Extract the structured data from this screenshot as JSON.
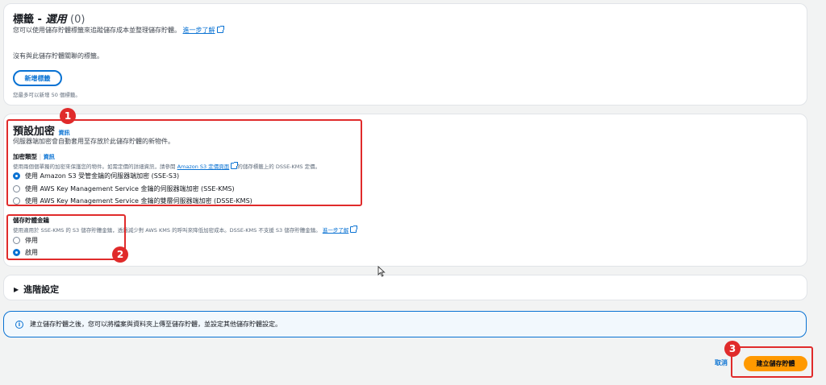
{
  "tags": {
    "title": "標籤 - ",
    "title_italic": "選用",
    "count": "(0)",
    "description": "您可以使用儲存貯體標籤來追蹤儲存成本並整理儲存貯體。",
    "learn_more": "進一步了解",
    "empty_text": "沒有與此儲存貯體關聯的標籤。",
    "add_button": "新增標籤",
    "limit_note": "您最多可以新增 50 個標籤。"
  },
  "encryption": {
    "title": "預設加密",
    "info": "資訊",
    "description": "伺服器端加密會自動套用至存放於此儲存貯體的新物件。",
    "type_label": "加密類型",
    "type_info": "資訊",
    "type_note_prefix": "使用兩個個單獨的加密來保護您的物件。如需定價的詳細資訊，請參閱 ",
    "type_note_link": "Amazon S3 定價頁面",
    "type_note_suffix": "的儲存標籤上的 DSSE-KMS 定價。",
    "options": [
      "使用 Amazon S3 受管金鑰的伺服器端加密 (SSE-S3)",
      "使用 AWS Key Management Service 金鑰的伺服器端加密 (SSE-KMS)",
      "使用 AWS Key Management Service 金鑰的雙層伺服器端加密 (DSSE-KMS)"
    ],
    "selected": 0
  },
  "bucket_key": {
    "label": "儲存貯體金鑰",
    "note": "使用適用於 SSE-KMS 的 S3 儲存貯體金鑰，透過減少對 AWS KMS 的呼叫來降低加密成本。DSSE-KMS 不支援 S3 儲存貯體金鑰。",
    "learn_more": "進一步了解",
    "options": [
      "停用",
      "啟用"
    ],
    "selected": 1
  },
  "advanced": {
    "title": "進階設定"
  },
  "banner": {
    "text": "建立儲存貯體之後，您可以將檔案與資料夾上傳至儲存貯體，並設定其他儲存貯體設定。"
  },
  "footer": {
    "cancel": "取消",
    "create": "建立儲存貯體"
  },
  "badges": [
    "1",
    "2",
    "3"
  ],
  "colors": {
    "accent": "#0972d3",
    "primary_button": "#ff9900",
    "highlight": "#e02b2b"
  }
}
